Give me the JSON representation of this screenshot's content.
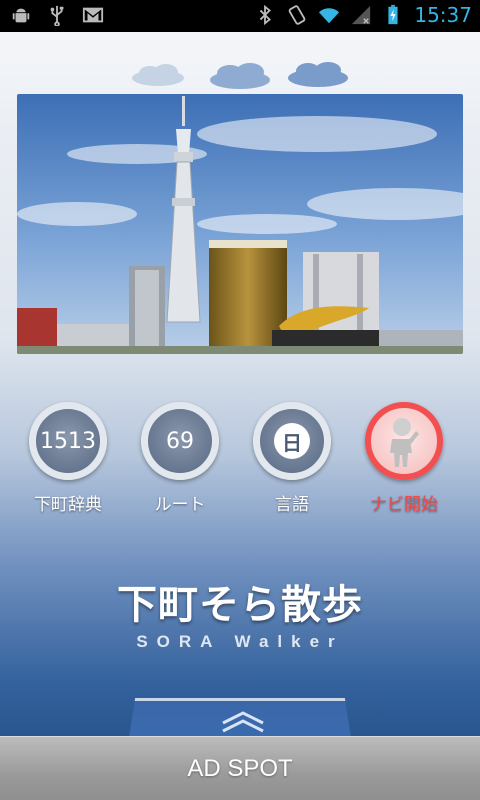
{
  "status_bar": {
    "time": "15:37",
    "left_icons": [
      "android-debug-icon",
      "usb-icon",
      "gmail-icon"
    ],
    "right_icons": [
      "bluetooth-icon",
      "rotate-icon",
      "wifi-icon",
      "signal-icon",
      "battery-charging-icon"
    ]
  },
  "header": {
    "decoration": "clouds"
  },
  "photo": {
    "subject": "tokyo-skytree-skyline"
  },
  "menu": {
    "items": [
      {
        "value": "1513",
        "label": "下町辞典"
      },
      {
        "value": "69",
        "label": "ルート"
      },
      {
        "value": "日",
        "label": "言語"
      },
      {
        "value": "",
        "label": "ナビ開始"
      }
    ]
  },
  "logo": {
    "title": "下町そら散歩",
    "subtitle": "SORA Walker"
  },
  "drawer": {
    "icon": "chevron-up-icon"
  },
  "ad": {
    "label": "AD SPOT"
  },
  "colors": {
    "accent": "#33b5e5",
    "nav_red": "#f24848",
    "ad_gray": "#9a9a9a"
  }
}
